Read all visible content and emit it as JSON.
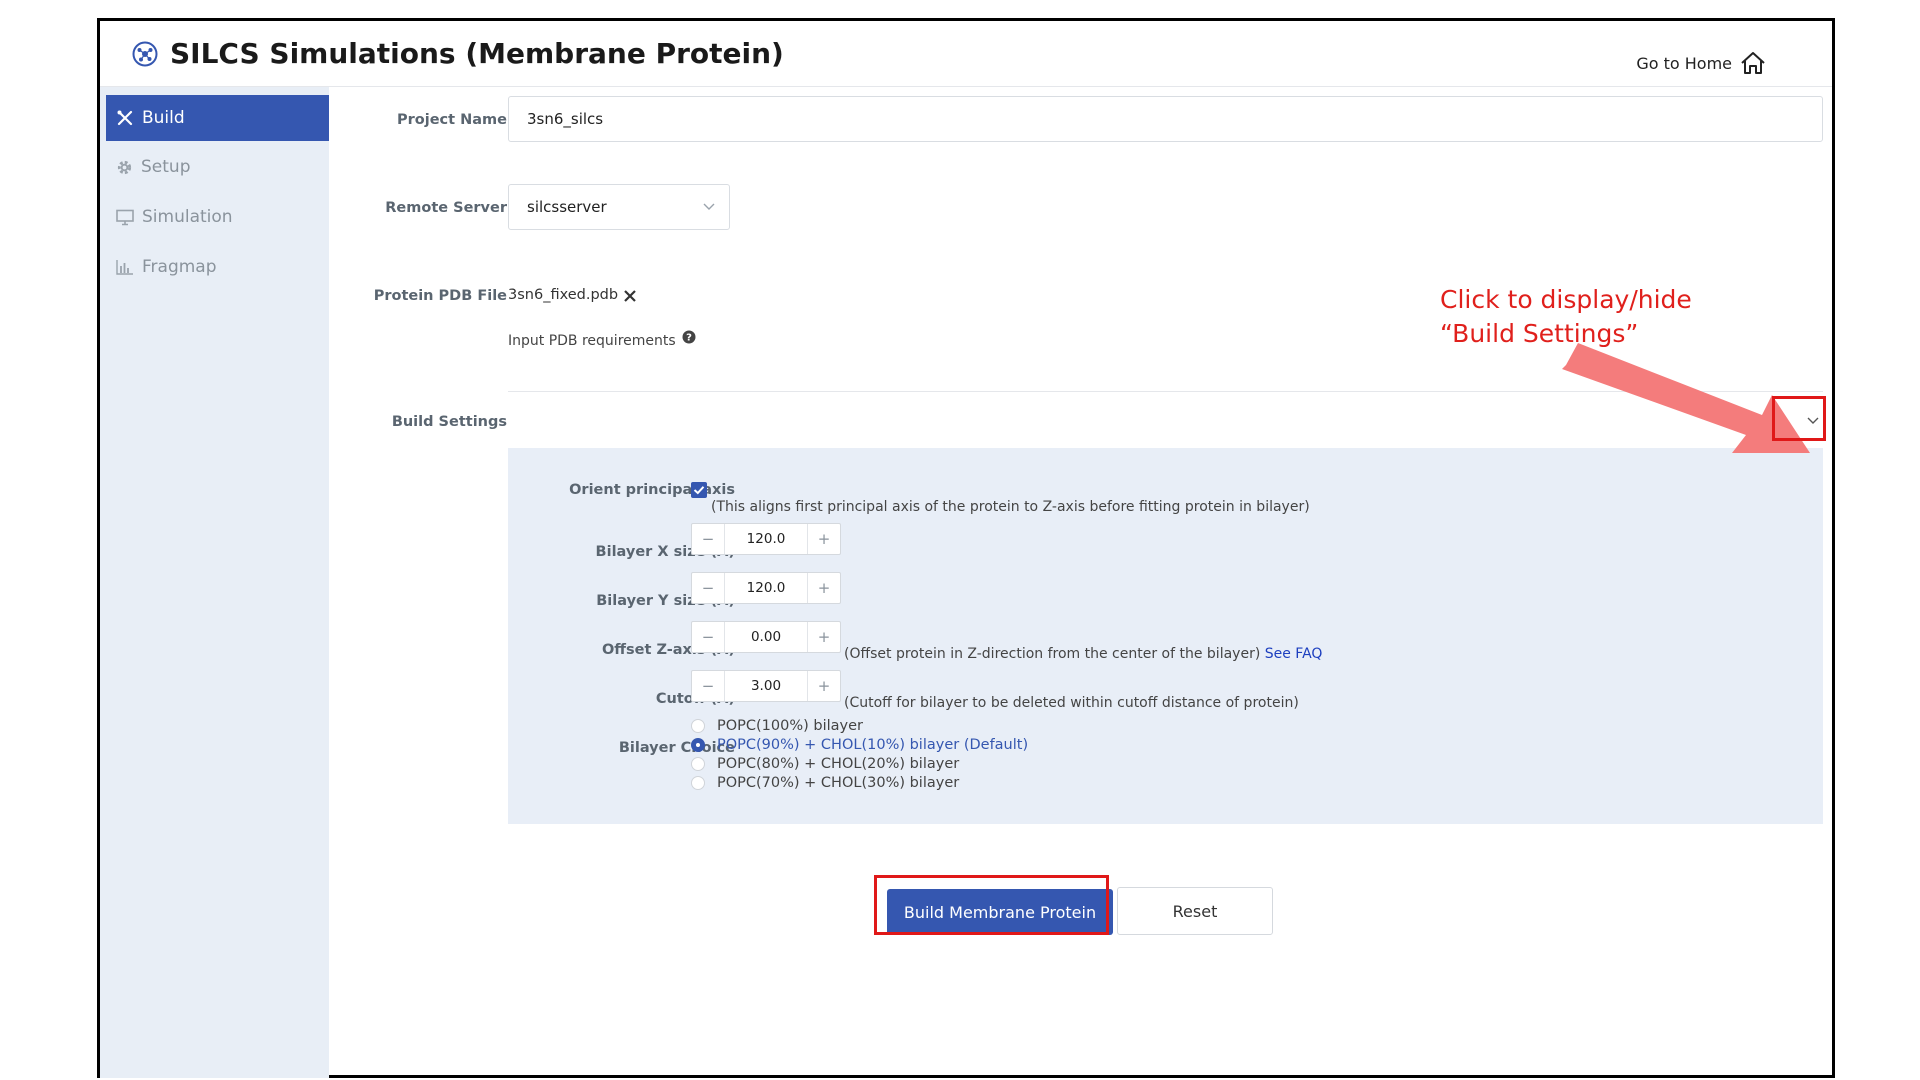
{
  "app": {
    "title": "SILCS Simulations (Membrane Protein)",
    "go_home": "Go to Home"
  },
  "sidebar": {
    "items": [
      {
        "label": "Build",
        "icon": "tools-icon",
        "active": true
      },
      {
        "label": "Setup",
        "icon": "gear-icon",
        "active": false
      },
      {
        "label": "Simulation",
        "icon": "monitor-icon",
        "active": false
      },
      {
        "label": "Fragmap",
        "icon": "bar-chart-icon",
        "active": false
      }
    ]
  },
  "form": {
    "project_name_label": "Project Name",
    "project_name_value": "3sn6_silcs",
    "remote_server_label": "Remote Server",
    "remote_server_value": "silcsserver",
    "pdb_label": "Protein PDB File",
    "pdb_file": "3sn6_fixed.pdb",
    "pdb_requirements": "Input PDB requirements",
    "build_settings_label": "Build Settings"
  },
  "settings": {
    "orient_label": "Orient principal axis",
    "orient_checked": true,
    "orient_note": "(This aligns first principal axis of the protein to Z-axis before fitting protein in bilayer)",
    "bilayer_x_label": "Bilayer X size (Å)",
    "bilayer_x_value": "120.0",
    "bilayer_y_label": "Bilayer Y size (Å)",
    "bilayer_y_value": "120.0",
    "offset_label": "Offset Z-axis (Å)",
    "offset_value": "0.00",
    "offset_note": "(Offset protein in Z-direction from the center of the bilayer)",
    "offset_link": "See FAQ",
    "cutoff_label": "Cutoff (Å)",
    "cutoff_value": "3.00",
    "cutoff_note": "(Cutoff for bilayer to be deleted within cutoff distance of protein)",
    "bilayer_choice_label": "Bilayer Choice",
    "bilayer_options": [
      {
        "label": "POPC(100%) bilayer",
        "selected": false
      },
      {
        "label": "POPC(90%) + CHOL(10%) bilayer (Default)",
        "selected": true
      },
      {
        "label": "POPC(80%) + CHOL(20%) bilayer",
        "selected": false
      },
      {
        "label": "POPC(70%) + CHOL(30%) bilayer",
        "selected": false
      }
    ],
    "minus": "−",
    "plus": "+"
  },
  "actions": {
    "build_label": "Build Membrane Protein",
    "reset_label": "Reset"
  },
  "annotation": {
    "line1": "Click to display/hide",
    "line2": "“Build Settings”"
  },
  "colors": {
    "accent": "#3557b0",
    "sidebar_bg": "#e8eef6",
    "panel_bg": "#e8eef7",
    "annotation_red": "#e0201c",
    "arrow": "#f47c7c"
  }
}
